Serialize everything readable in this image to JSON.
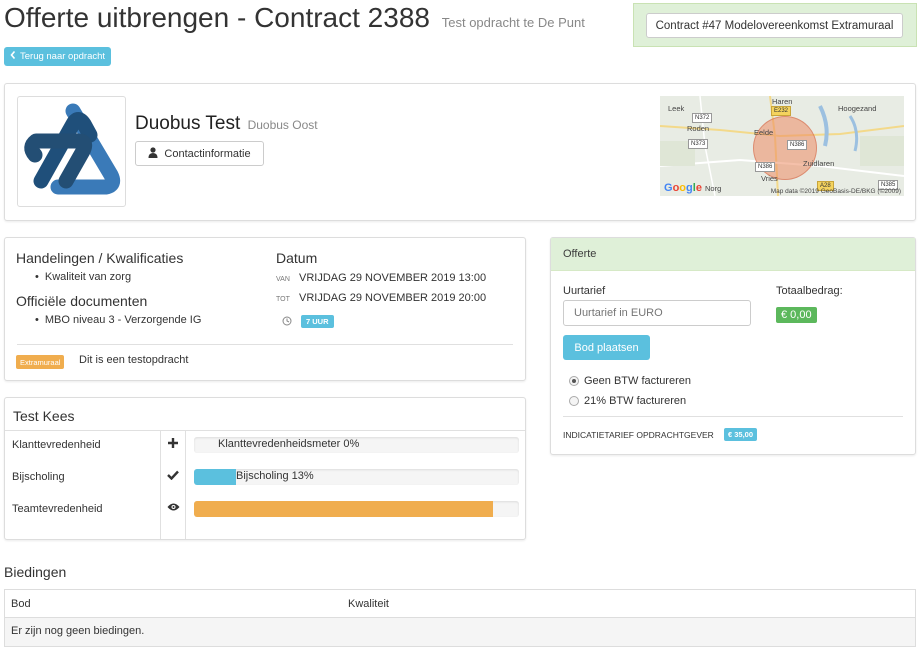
{
  "header": {
    "title": "Offerte uitbrengen - Contract 2388",
    "subtitle": "Test opdracht te De Punt",
    "contract_button": "Contract #47 Modelovereenkomst Extramuraal",
    "back_button": "Terug naar opdracht"
  },
  "client": {
    "name": "Duobus Test",
    "location": "Duobus Oost",
    "contact_button": "Contactinformatie",
    "map": {
      "places": [
        "Leek",
        "Roden",
        "Haren",
        "Hoogezand",
        "Eelde",
        "Zuidlaren",
        "Vries",
        "Norg"
      ],
      "roads": [
        "N372",
        "N373",
        "N386",
        "E232",
        "N386",
        "N385",
        "A28"
      ],
      "brand": "Google",
      "credit": "Map data ©2019 GeoBasis-DE/BKG (©2009)"
    }
  },
  "details": {
    "handelingen_title": "Handelingen / Kwalificaties",
    "handelingen": [
      "Kwaliteit van zorg"
    ],
    "documenten_title": "Officiële documenten",
    "documenten": [
      "MBO niveau 3 - Verzorgende IG"
    ],
    "datum_title": "Datum",
    "van_label": "VAN",
    "van_value": "VRIJDAG 29 NOVEMBER 2019 13:00",
    "tot_label": "TOT",
    "tot_value": "VRIJDAG 29 NOVEMBER 2019 20:00",
    "duration": "7 UUR",
    "extra_badge": "Extramuraal",
    "extra_note": "Dit is een testopdracht",
    "colors": {
      "info": "#5bc0de",
      "warning": "#f0ad4e"
    }
  },
  "metrics": {
    "title": "Test Kees",
    "rows": [
      {
        "label": "Klanttevredenheid",
        "icon": "plus-icon",
        "bar_text": "Klanttevredenheidsmeter 0%",
        "percent": 0,
        "color": "#5bc0de"
      },
      {
        "label": "Bijscholing",
        "icon": "check-icon",
        "bar_text": "Bijscholing 13%",
        "percent": 13,
        "color": "#5bc0de"
      },
      {
        "label": "Teamtevredenheid",
        "icon": "eye-icon",
        "bar_text": "",
        "percent": 92,
        "color": "#f0ad4e"
      }
    ]
  },
  "offer": {
    "title": "Offerte",
    "rate_label": "Uurtarief",
    "rate_placeholder": "Uurtarief in EURO",
    "total_label": "Totaalbedrag:",
    "total_value": "€ 0,00",
    "bid_button": "Bod plaatsen",
    "vat_options": [
      {
        "label": "Geen BTW factureren",
        "checked": true
      },
      {
        "label": "21% BTW factureren",
        "checked": false
      }
    ],
    "indicative_label": "INDICATIETARIEF OPDRACHTGEVER",
    "indicative_value": "€ 35,00",
    "colors": {
      "success": "#5cb85c",
      "header_bg": "#dff0d8"
    }
  },
  "bids": {
    "title": "Biedingen",
    "columns": [
      "Bod",
      "Kwaliteit"
    ],
    "empty_text": "Er zijn nog geen biedingen."
  }
}
